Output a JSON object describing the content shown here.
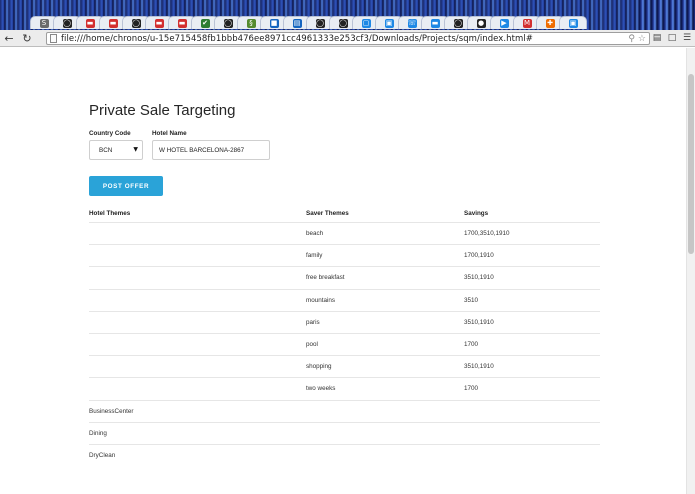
{
  "browser": {
    "url": "file:///home/chronos/u-15e715458fb1bbb476ee8971cc4961333e253cf3/Downloads/Projects/sqm/index.html#",
    "tabs": [
      {
        "icon": "S",
        "color": "#6b6b6b"
      },
      {
        "icon": "◯",
        "color": "#222222"
      },
      {
        "icon": "▬",
        "color": "#d32f2f"
      },
      {
        "icon": "▬",
        "color": "#d32f2f"
      },
      {
        "icon": "◯",
        "color": "#222222"
      },
      {
        "icon": "▬",
        "color": "#d32f2f"
      },
      {
        "icon": "▬",
        "color": "#d32f2f"
      },
      {
        "icon": "✔",
        "color": "#2e7d32"
      },
      {
        "icon": "◯",
        "color": "#222222"
      },
      {
        "icon": "§",
        "color": "#558b2f"
      },
      {
        "icon": "■",
        "color": "#1565c0"
      },
      {
        "icon": "▤",
        "color": "#1565c0"
      },
      {
        "icon": "◯",
        "color": "#222222"
      },
      {
        "icon": "◯",
        "color": "#222222"
      },
      {
        "icon": "▢",
        "color": "#1e88e5"
      },
      {
        "icon": "▣",
        "color": "#1e88e5"
      },
      {
        "icon": "☏",
        "color": "#1e88e5"
      },
      {
        "icon": "▬",
        "color": "#1e88e5"
      },
      {
        "icon": "◯",
        "color": "#222222"
      },
      {
        "icon": "●",
        "color": "#222222"
      },
      {
        "icon": "▶",
        "color": "#1e88e5"
      },
      {
        "icon": "M",
        "color": "#d32f2f"
      },
      {
        "icon": "✚",
        "color": "#ef6c00"
      },
      {
        "icon": "▣",
        "color": "#1e88e5"
      }
    ]
  },
  "page": {
    "title": "Private Sale Targeting",
    "form": {
      "country_code_label": "Country Code",
      "country_code_value": "BCN",
      "hotel_name_label": "Hotel Name",
      "hotel_name_value": "W HOTEL BARCELONA-2867",
      "post_button_label": "POST OFFER"
    },
    "table": {
      "headers": [
        "Hotel Themes",
        "Saver Themes",
        "Savings"
      ],
      "rows": [
        [
          "",
          "beach",
          "1700,3510,1910"
        ],
        [
          "",
          "family",
          "1700,1910"
        ],
        [
          "",
          "free breakfast",
          "3510,1910"
        ],
        [
          "",
          "mountains",
          "3510"
        ],
        [
          "",
          "paris",
          "3510,1910"
        ],
        [
          "",
          "pool",
          "1700"
        ],
        [
          "",
          "shopping",
          "3510,1910"
        ],
        [
          "",
          "two weeks",
          "1700"
        ],
        [
          "BusinessCenter",
          "",
          ""
        ],
        [
          "Dining",
          "",
          ""
        ],
        [
          "DryClean",
          "",
          ""
        ]
      ]
    }
  },
  "colors": {
    "accent_button": "#2aa3d8",
    "row_divider": "#e6e6e6"
  }
}
